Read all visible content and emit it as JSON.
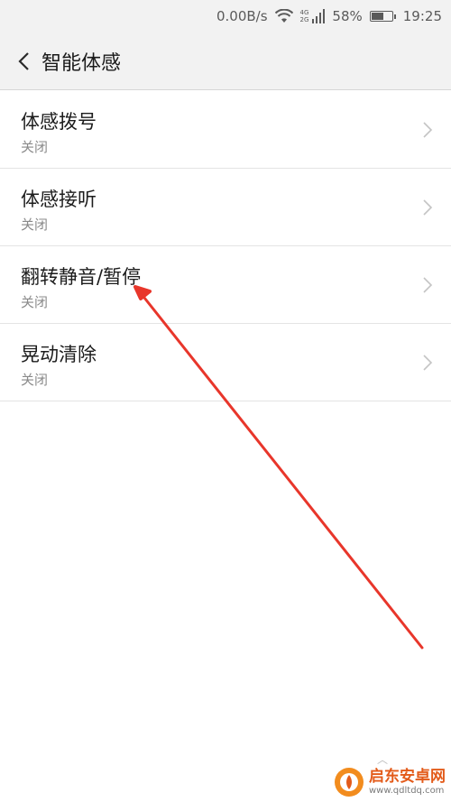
{
  "status_bar": {
    "speed": "0.00B/s",
    "net_top": "4G",
    "net_bottom": "2G",
    "battery_percent": "58%",
    "battery_level": 0.58,
    "time": "19:25"
  },
  "header": {
    "title": "智能体感"
  },
  "items": [
    {
      "title": "体感拨号",
      "status": "关闭"
    },
    {
      "title": "体感接听",
      "status": "关闭"
    },
    {
      "title": "翻转静音/暂停",
      "status": "关闭"
    },
    {
      "title": "晃动清除",
      "status": "关闭"
    }
  ],
  "watermark": {
    "name": "启东安卓网",
    "url": "www.qdltdq.com"
  },
  "colors": {
    "arrow": "#e8362b",
    "bar_background": "#f2f2f2"
  }
}
